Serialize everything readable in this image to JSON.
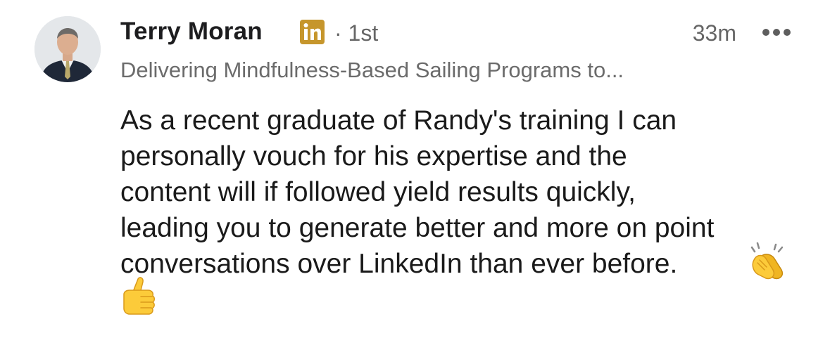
{
  "post": {
    "author": {
      "name": "Terry Moran",
      "degree": "1st",
      "headline": "Delivering Mindfulness-Based Sailing Programs to...",
      "badge_icon": "linkedin-icon",
      "badge_color": "#c6962c"
    },
    "timestamp": "33m",
    "more_icon": "more-horizontal-icon",
    "text_lines": [
      "As a recent graduate of Randy's training I can",
      "personally vouch for his expertise and the",
      "content will if followed yield results quickly,",
      "leading you to generate better and more on point",
      "conversations over LinkedIn than ever before."
    ],
    "emojis": [
      "clapping-hands-icon",
      "thumbs-up-icon"
    ]
  }
}
